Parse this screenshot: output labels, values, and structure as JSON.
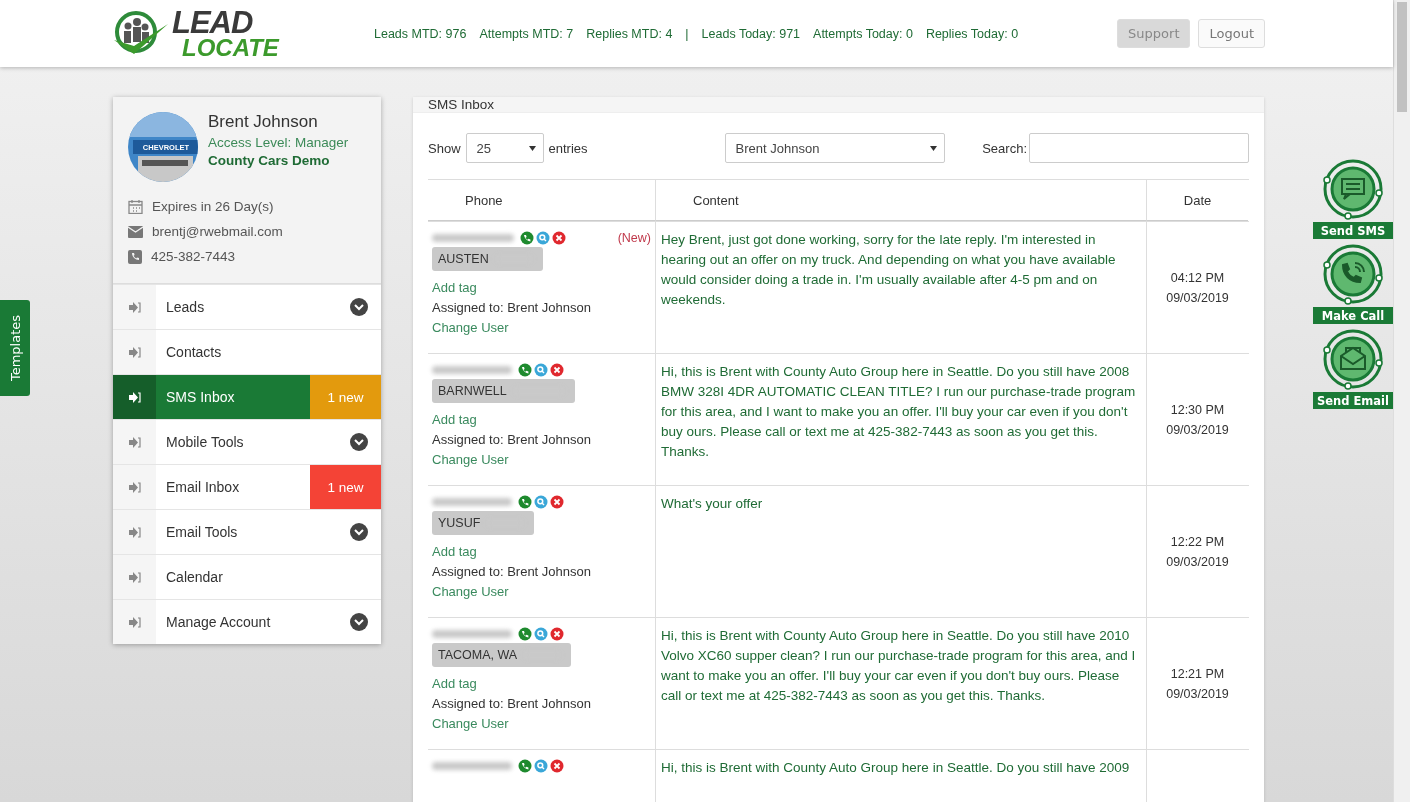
{
  "header": {
    "logo": {
      "line1": "LEAD",
      "line2": "LOCATE"
    },
    "stats": [
      "Leads MTD: 976",
      "Attempts MTD: 7",
      "Replies MTD: 4",
      "|",
      "Leads Today: 971",
      "Attempts Today: 0",
      "Replies Today: 0"
    ],
    "buttons": [
      {
        "label": "Support",
        "selected": true
      },
      {
        "label": "Logout",
        "selected": false
      }
    ]
  },
  "profile": {
    "name": "Brent Johnson",
    "access": "Access Level: Manager",
    "company": "County Cars Demo",
    "avatar_text": "CHEVROLET",
    "details": [
      {
        "kind": "calendar",
        "text": "Expires in 26 Day(s)"
      },
      {
        "kind": "mail",
        "text": "brentj@rwebmail.com"
      },
      {
        "kind": "phone",
        "text": "425-382-7443"
      }
    ]
  },
  "menu": [
    {
      "label": "Leads",
      "selected": false,
      "kind": "dropdown"
    },
    {
      "label": "Contacts",
      "selected": false,
      "kind": "plain"
    },
    {
      "label": "SMS Inbox",
      "selected": true,
      "kind": "badge",
      "badge": "1 new",
      "color": "#e39a0d"
    },
    {
      "label": "Mobile Tools",
      "selected": false,
      "kind": "dropdown"
    },
    {
      "label": "Email Inbox",
      "selected": false,
      "kind": "badge",
      "badge": "1 new",
      "color": "#f44336"
    },
    {
      "label": "Email Tools",
      "selected": false,
      "kind": "dropdown"
    },
    {
      "label": "Calendar",
      "selected": false,
      "kind": "plain"
    },
    {
      "label": "Manage Account",
      "selected": false,
      "kind": "dropdown"
    }
  ],
  "templates_tab": "Templates",
  "inbox": {
    "title": "SMS Inbox",
    "show_label": "Show",
    "page_size": "25",
    "entries_label": "entries",
    "user_filter": "Brent Johnson",
    "search_label": "Search:",
    "columns": [
      "Phone",
      "Content",
      "Date"
    ],
    "rows": [
      {
        "status": "(New)",
        "tag": "AUSTEN",
        "add_tag": "Add tag",
        "assigned": "Assigned to: Brent Johnson",
        "change_user": "Change User",
        "content": "Hey Brent, just got done working, sorry for the late reply. I'm interested in hearing out an offer on my truck. And depending on what you have available would consider doing a trade in. I'm usually available after 4-5 pm and on weekends.",
        "time": "04:12 PM",
        "date": "09/03/2019"
      },
      {
        "tag": "BARNWELL",
        "add_tag": "Add tag",
        "assigned": "Assigned to: Brent Johnson",
        "change_user": "Change User",
        "content": "Hi, this is Brent with County Auto Group here in Seattle. Do you still have 2008 BMW 328I 4DR AUTOMATIC CLEAN TITLE? I run our purchase-trade program for this area, and I want to make you an offer. I'll buy your car even if you don't buy ours. Please call or text me at 425-382-7443 as soon as you get this. Thanks.",
        "time": "12:30 PM",
        "date": "09/03/2019"
      },
      {
        "tag": "YUSUF",
        "add_tag": "Add tag",
        "assigned": "Assigned to: Brent Johnson",
        "change_user": "Change User",
        "content": "What's your offer",
        "time": "12:22 PM",
        "date": "09/03/2019"
      },
      {
        "tag": "TACOMA, WA",
        "add_tag": "Add tag",
        "assigned": "Assigned to: Brent Johnson",
        "change_user": "Change User",
        "content": "Hi, this is Brent with County Auto Group here in Seattle. Do you still have 2010 Volvo XC60 supper clean? I run our purchase-trade program for this area, and I want to make you an offer. I'll buy your car even if you don't buy ours. Please call or text me at 425-382-7443 as soon as you get this. Thanks.",
        "time": "12:21 PM",
        "date": "09/03/2019"
      },
      {
        "content": "Hi, this is Brent with County Auto Group here in Seattle. Do you still have 2009"
      }
    ]
  },
  "actions": [
    {
      "kind": "sms",
      "label": "Send SMS"
    },
    {
      "kind": "call",
      "label": "Make Call"
    },
    {
      "kind": "email",
      "label": "Send Email"
    }
  ]
}
